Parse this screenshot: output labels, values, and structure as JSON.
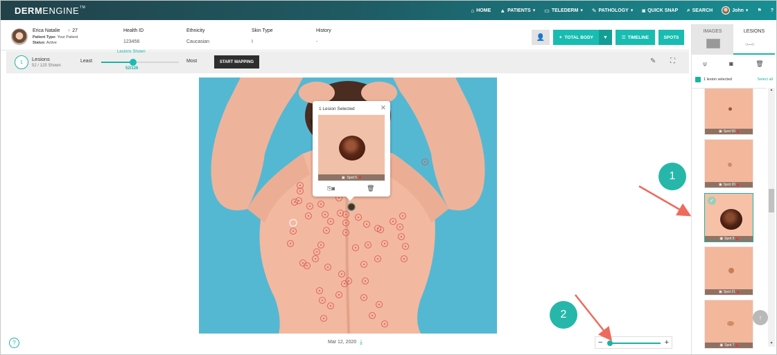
{
  "nav": {
    "logo_bold": "DERM",
    "logo_light": "ENGINE",
    "logo_tm": "TM",
    "items": [
      {
        "label": "HOME",
        "icon": "home-icon",
        "glyph": "⌂"
      },
      {
        "label": "PATIENTS",
        "icon": "patients-icon",
        "glyph": "👥",
        "caret": "▾"
      },
      {
        "label": "TELEDERM",
        "icon": "telederm-icon",
        "glyph": "🖵",
        "caret": "▾"
      },
      {
        "label": "PATHOLOGY",
        "icon": "pathology-icon",
        "glyph": "⚗",
        "caret": "▾"
      },
      {
        "label": "QUICK SNAP",
        "icon": "quick-snap-icon",
        "glyph": "📷"
      },
      {
        "label": "SEARCH",
        "icon": "search-icon",
        "glyph": "⌕"
      }
    ],
    "user_name": "John",
    "user_caret": "▾",
    "bell_glyph": "🔔",
    "help_glyph": "?"
  },
  "patient": {
    "name": "Erica Natalie",
    "age": "27",
    "type_label": "Patient Type:",
    "type_value": "Your Patient",
    "status_label": "Status:",
    "status_value": "Active",
    "columns": [
      {
        "label": "Health ID",
        "value": "123456"
      },
      {
        "label": "Ethnicity",
        "value": "Caucasian"
      },
      {
        "label": "Skin Type",
        "value": "I"
      },
      {
        "label": "History",
        "value": "-"
      }
    ]
  },
  "toolbar": {
    "total_body_label": "TOTAL BODY",
    "timeline_label": "TIMELINE",
    "spots_label": "SPOTS"
  },
  "lesions_bar": {
    "count_badge": "1",
    "title": "Lesions",
    "subtitle": "52 / 125 Shown",
    "least_label": "Least",
    "most_label": "Most",
    "shown_label": "Lesions Shown",
    "shown_value": "52/126",
    "slider_fraction": 0.41,
    "start_mapping_label": "START MAPPING"
  },
  "popup": {
    "title": "1 Lesion Selected",
    "close_glyph": "✕",
    "caption": "Spot 5"
  },
  "image_date": "Mar 12, 2020",
  "zoom": {
    "minus": "−",
    "plus": "+",
    "fraction": 0.0
  },
  "panel": {
    "tab_images": "IMAGES",
    "tab_lesions": "LESIONS",
    "selection_text": "1 lesion selected",
    "select_all": "Select all",
    "thumbnails": [
      {
        "caption": "Spot 50",
        "selected": false
      },
      {
        "caption": "Spot 20",
        "selected": false
      },
      {
        "caption": "Spot 5",
        "selected": true
      },
      {
        "caption": "Spot 21",
        "selected": false
      },
      {
        "caption": "Spot 7",
        "selected": false
      }
    ]
  },
  "annotations": [
    {
      "number": "1"
    },
    {
      "number": "2"
    }
  ],
  "colors": {
    "accent": "#19b3a6",
    "annotation": "#26b7aa",
    "arrow": "#ee6a5d",
    "lesion_marker": "#d9534f"
  }
}
